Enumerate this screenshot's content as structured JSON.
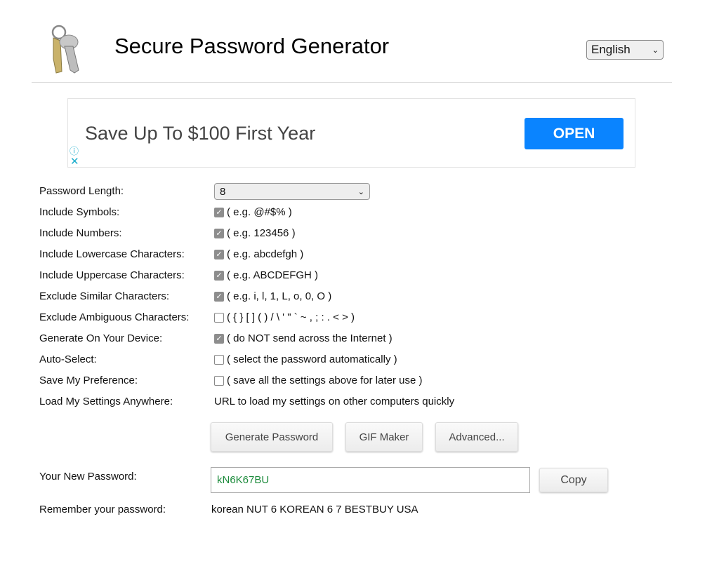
{
  "header": {
    "title": "Secure Password Generator",
    "language": "English",
    "logo": "keys-icon"
  },
  "ad": {
    "headline": "Save Up To $100 First Year",
    "button": "OPEN"
  },
  "form": {
    "length": {
      "label": "Password Length:",
      "value": "8"
    },
    "rows": [
      {
        "label": "Include Symbols:",
        "checked": true,
        "hint": "( e.g. @#$% )"
      },
      {
        "label": "Include Numbers:",
        "checked": true,
        "hint": "( e.g. 123456 )"
      },
      {
        "label": "Include Lowercase Characters:",
        "checked": true,
        "hint": "( e.g. abcdefgh )"
      },
      {
        "label": "Include Uppercase Characters:",
        "checked": true,
        "hint": "( e.g. ABCDEFGH )"
      },
      {
        "label": "Exclude Similar Characters:",
        "checked": true,
        "hint": "( e.g. i, l, 1, L, o, 0, O )"
      },
      {
        "label": "Exclude Ambiguous Characters:",
        "checked": false,
        "hint": "( { } [ ] ( ) / \\ ' \" ` ~ , ; : . < > )"
      },
      {
        "label": "Generate On Your Device:",
        "checked": true,
        "hint": "( do NOT send across the Internet )"
      },
      {
        "label": "Auto-Select:",
        "checked": false,
        "hint": "( select the password automatically )"
      },
      {
        "label": "Save My Preference:",
        "checked": false,
        "hint": "( save all the settings above for later use )"
      }
    ],
    "load": {
      "label": "Load My Settings Anywhere:",
      "text": "URL to load my settings on other computers quickly"
    }
  },
  "buttons": {
    "generate": "Generate Password",
    "gif": "GIF Maker",
    "advanced": "Advanced..."
  },
  "result": {
    "label": "Your New Password:",
    "password": "kN6K67BU",
    "copy": "Copy",
    "remember_label": "Remember your password:",
    "remember": "korean NUT 6 KOREAN 6 7 BESTBUY USA"
  }
}
